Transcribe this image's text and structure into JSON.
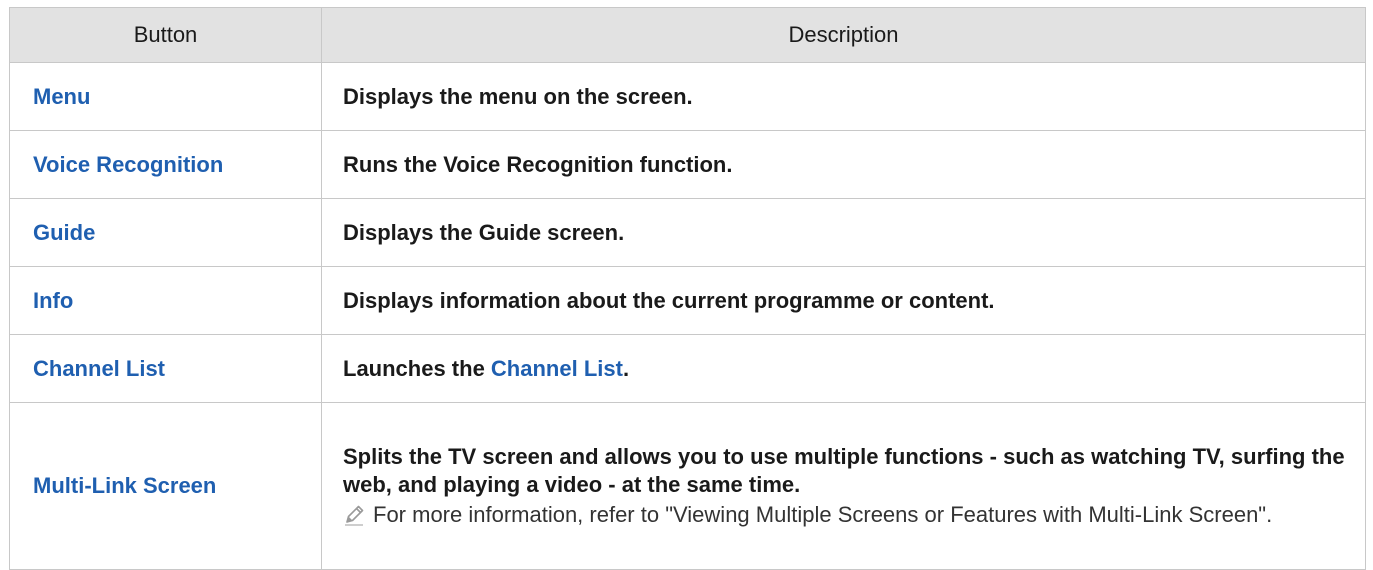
{
  "table": {
    "headers": {
      "button": "Button",
      "description": "Description"
    },
    "rows": [
      {
        "button": "Menu",
        "description": "Displays the menu on the screen."
      },
      {
        "button": "Voice Recognition",
        "description": "Runs the Voice Recognition function."
      },
      {
        "button": "Guide",
        "description": "Displays the Guide screen."
      },
      {
        "button": "Info",
        "description": "Displays information about the current programme or content."
      },
      {
        "button": "Channel List",
        "description_prefix": "Launches the ",
        "description_link": "Channel List",
        "description_suffix": "."
      },
      {
        "button": "Multi-Link Screen",
        "description": "Splits the TV screen and allows you to use multiple functions - such as watching TV, surfing the web, and playing a video - at the same time.",
        "note": "For more information, refer to \"Viewing Multiple Screens or Features with Multi-Link Screen\".",
        "note_icon": "pencil-icon"
      }
    ]
  },
  "colors": {
    "link": "#1f5fb0",
    "header_bg": "#e2e2e2",
    "border": "#c8c8c8"
  }
}
